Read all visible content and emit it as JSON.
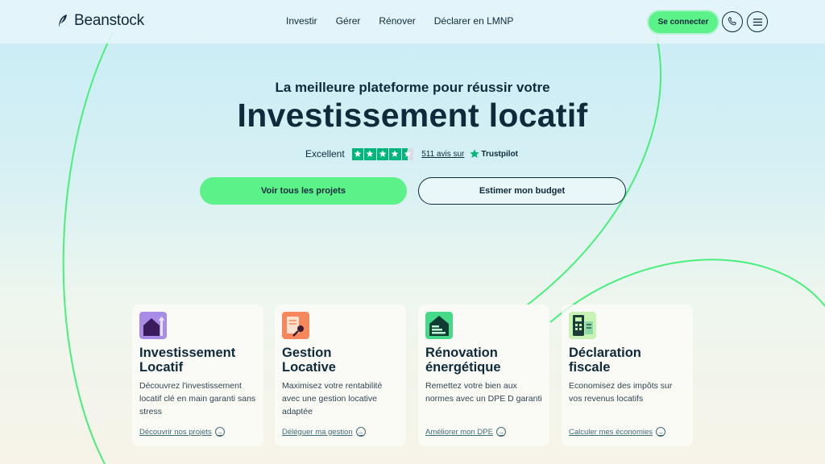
{
  "brand": {
    "name": "Beanstock"
  },
  "nav": {
    "items": [
      "Investir",
      "Gérer",
      "Rénover",
      "Déclarer en LMNP"
    ]
  },
  "header": {
    "login_label": "Se connecter",
    "phone_icon": "phone-icon",
    "menu_icon": "menu-icon"
  },
  "hero": {
    "subtitle": "La meilleure plateforme pour réussir votre",
    "title": "Investissement locatif",
    "rating_label": "Excellent",
    "rating_stars": 4.5,
    "reviews_link": "511 avis sur",
    "trustpilot": "Trustpilot",
    "cta_primary": "Voir tous les projets",
    "cta_secondary": "Estimer mon budget"
  },
  "cards": [
    {
      "title": "Investissement\nLocatif",
      "description": "Découvrez l'investissement locatif clé en main garanti sans stress",
      "link": "Découvrir nos projets",
      "icon": "house-icon",
      "icon_color": "#a98be8"
    },
    {
      "title": "Gestion\nLocative",
      "description": " Maximisez votre rentabilité avec une gestion locative adaptée",
      "link": "Déléguer ma gestion",
      "icon": "document-key-icon",
      "icon_color": "#f6875a"
    },
    {
      "title": "Rénovation\nénergétique",
      "description": "Remettez votre bien aux normes avec un DPE D garanti",
      "link": "Améliorer mon DPE",
      "icon": "energy-house-icon",
      "icon_color": "#47d98a"
    },
    {
      "title": "Déclaration\nfiscale",
      "description": "Economisez des impôts sur vos revenus locatifs",
      "link": "Calculer mes économies",
      "icon": "calculator-icon",
      "icon_color": "#c9f2b5"
    }
  ],
  "colors": {
    "accent": "#5cf28a",
    "text": "#0e2a3b",
    "trustpilot": "#00b67a"
  }
}
